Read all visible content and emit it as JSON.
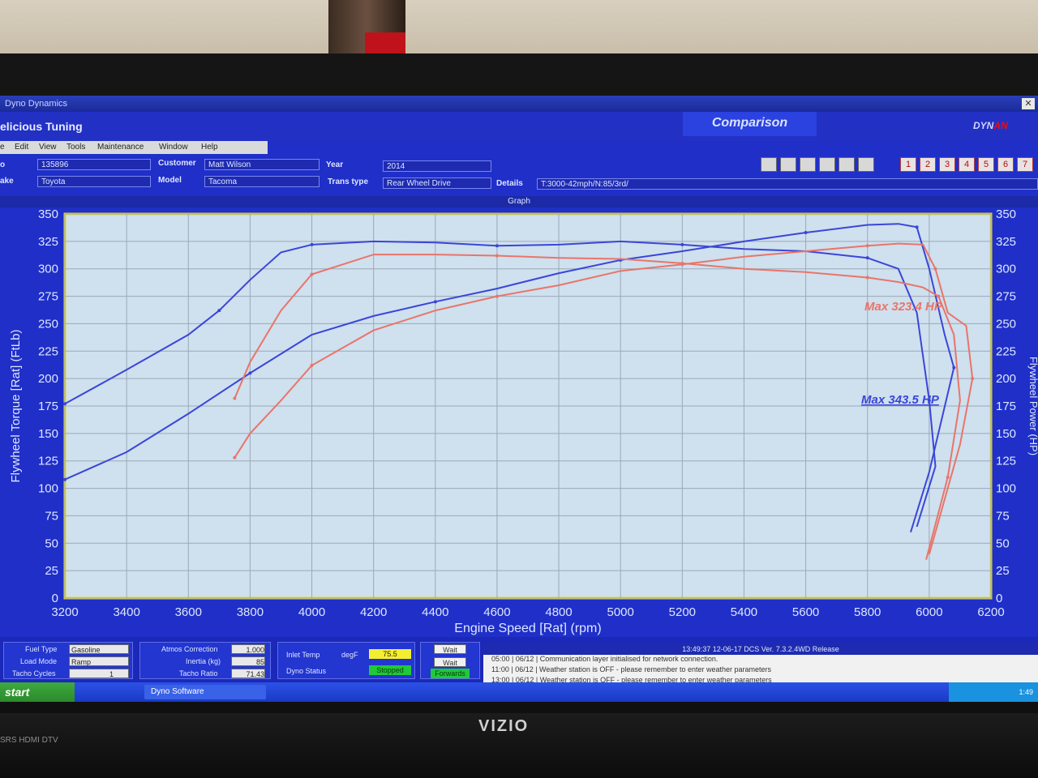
{
  "window": {
    "title": "Dyno Dynamics",
    "app_title": "elicious Tuning",
    "mode": "Comparison",
    "logo_a": "DYN",
    "logo_b": "AN",
    "close": "✕"
  },
  "menu": [
    "e",
    "Edit",
    "View",
    "Tools",
    "Maintenance",
    "Window",
    "Help"
  ],
  "vehicle": {
    "field1": "135896",
    "field1_label": "o",
    "make_label": "ake",
    "make": "Toyota",
    "customer_label": "Customer",
    "customer": "Matt Wilson",
    "model_label": "Model",
    "model": "Tacoma",
    "year_label": "Year",
    "year": "2014",
    "trans_label": "Trans type",
    "trans": "Rear Wheel Drive",
    "details_label": "Details",
    "details": "T:3000-42mph/N:85/3rd/"
  },
  "number_buttons": [
    "1",
    "2",
    "3",
    "4",
    "5",
    "6",
    "7"
  ],
  "graph_header": "Graph",
  "chart_data": {
    "type": "line",
    "xlabel": "Engine Speed [Rat] (rpm)",
    "ylabel": "Flywheel Torque [Rat] (FtLb)",
    "ylabel_right": "Flywheel Power (HP)",
    "xlim": [
      3200,
      6200
    ],
    "ylim": [
      0,
      350
    ],
    "x_ticks": [
      3200,
      3400,
      3600,
      3800,
      4000,
      4200,
      4400,
      4600,
      4800,
      5000,
      5200,
      5400,
      5600,
      5800,
      6000,
      6200
    ],
    "y_ticks": [
      0,
      25,
      50,
      75,
      100,
      125,
      150,
      175,
      200,
      225,
      250,
      275,
      300,
      325,
      350
    ],
    "grid": true,
    "series": [
      {
        "color": "#3a46d8",
        "points": [
          [
            3200,
            177
          ],
          [
            3400,
            208
          ],
          [
            3600,
            240
          ],
          [
            3700,
            262
          ],
          [
            3800,
            290
          ],
          [
            3900,
            315
          ],
          [
            4000,
            322
          ],
          [
            4200,
            325
          ],
          [
            4400,
            324
          ],
          [
            4600,
            321
          ],
          [
            4800,
            322
          ],
          [
            5000,
            325
          ],
          [
            5200,
            322
          ],
          [
            5400,
            318
          ],
          [
            5600,
            316
          ],
          [
            5800,
            310
          ],
          [
            5900,
            300
          ],
          [
            5960,
            260
          ],
          [
            6000,
            180
          ],
          [
            6020,
            120
          ],
          [
            5960,
            65
          ]
        ]
      },
      {
        "color": "#3a46d8",
        "points": [
          [
            3200,
            108
          ],
          [
            3400,
            133
          ],
          [
            3600,
            168
          ],
          [
            3800,
            205
          ],
          [
            4000,
            240
          ],
          [
            4200,
            257
          ],
          [
            4400,
            270
          ],
          [
            4600,
            282
          ],
          [
            4800,
            296
          ],
          [
            5000,
            308
          ],
          [
            5200,
            316
          ],
          [
            5400,
            325
          ],
          [
            5600,
            333
          ],
          [
            5800,
            340
          ],
          [
            5900,
            341
          ],
          [
            5960,
            338
          ],
          [
            6000,
            300
          ],
          [
            6050,
            240
          ],
          [
            6080,
            210
          ],
          [
            6000,
            115
          ],
          [
            5940,
            60
          ]
        ]
      },
      {
        "color": "#e8756a",
        "points": [
          [
            3750,
            182
          ],
          [
            3800,
            215
          ],
          [
            3900,
            262
          ],
          [
            4000,
            295
          ],
          [
            4200,
            313
          ],
          [
            4400,
            313
          ],
          [
            4600,
            312
          ],
          [
            4800,
            310
          ],
          [
            5000,
            309
          ],
          [
            5200,
            305
          ],
          [
            5400,
            300
          ],
          [
            5600,
            297
          ],
          [
            5800,
            292
          ],
          [
            5900,
            288
          ],
          [
            5980,
            283
          ],
          [
            6030,
            275
          ],
          [
            6080,
            240
          ],
          [
            6100,
            180
          ],
          [
            6060,
            110
          ],
          [
            5990,
            35
          ]
        ]
      },
      {
        "color": "#e8756a",
        "points": [
          [
            3750,
            128
          ],
          [
            3800,
            150
          ],
          [
            3900,
            180
          ],
          [
            4000,
            212
          ],
          [
            4200,
            244
          ],
          [
            4400,
            262
          ],
          [
            4600,
            275
          ],
          [
            4800,
            285
          ],
          [
            5000,
            298
          ],
          [
            5200,
            304
          ],
          [
            5400,
            311
          ],
          [
            5600,
            316
          ],
          [
            5800,
            321
          ],
          [
            5900,
            323
          ],
          [
            5980,
            322
          ],
          [
            6020,
            300
          ],
          [
            6060,
            260
          ],
          [
            6120,
            248
          ],
          [
            6140,
            200
          ],
          [
            6100,
            140
          ],
          [
            6000,
            40
          ]
        ]
      }
    ],
    "annotations": [
      {
        "text": "Max 323.4 HP",
        "color": "#e8756a"
      },
      {
        "text": "Max 343.5 HP",
        "color": "#3a46d8"
      }
    ]
  },
  "bottom": {
    "fuel_type_label": "Fuel Type",
    "fuel_type": "Gasoline",
    "load_mode_label": "Load Mode",
    "load_mode": "Ramp",
    "tacho_cycles_label": "Tacho Cycles",
    "tacho_cycles": "1",
    "atmos_label": "Atmos Correction",
    "atmos": "1.000",
    "inertia_label": "Inertia (kg)",
    "inertia": "85",
    "tacho_ratio_label": "Tacho Ratio",
    "tacho_ratio": "71.43",
    "inlet_temp_label": "Inlet Temp",
    "inlet_temp_unit": "degF",
    "inlet_temp": "75.5",
    "dyno_status_label": "Dyno Status",
    "dyno_status": "Stopped",
    "wait1": "Wait",
    "wait2": "Wait",
    "direction": "Forwards"
  },
  "log": {
    "header": "13:49:37      12-06-17  DCS Ver. 7.3.2.4WD Release",
    "lines": [
      "05:00 | 06/12 | Communication layer initialised for network connection.",
      "11:00 | 06/12 | Weather station is OFF - please remember to enter weather parameters",
      "13:00 | 06/12 | Weather station is OFF - please remember to enter weather parameters"
    ]
  },
  "taskbar": {
    "start": "start",
    "item": "Dyno Software",
    "clock": "1:49"
  },
  "monitor": {
    "brand": "VIZIO",
    "badges": "SRS  HDMI  DTV"
  }
}
